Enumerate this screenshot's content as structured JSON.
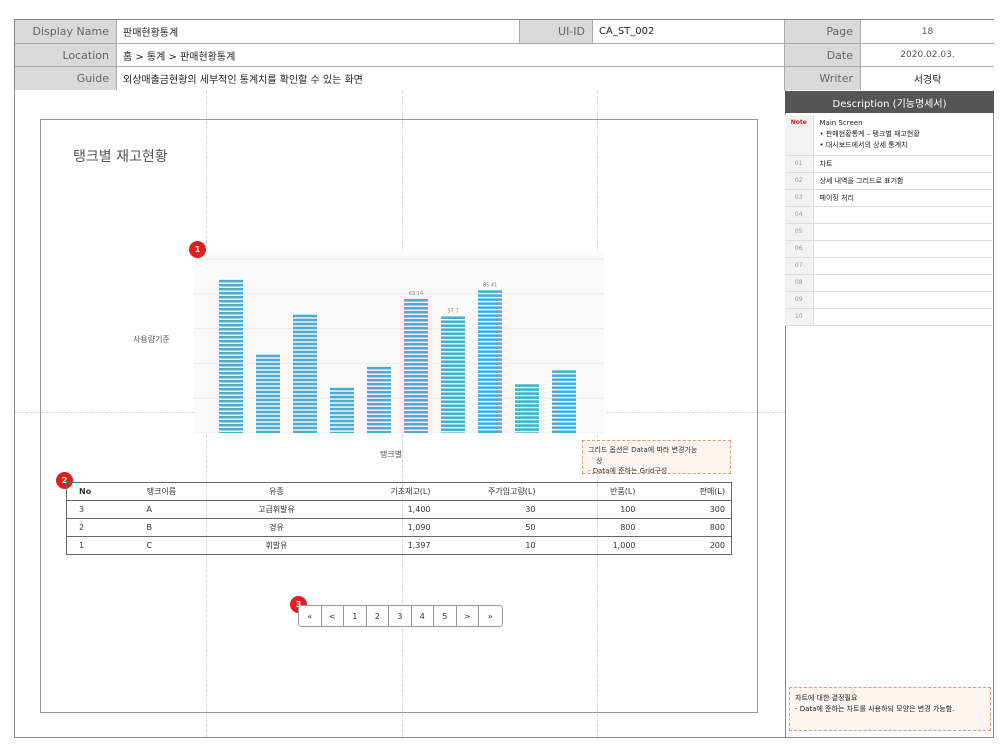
{
  "header": {
    "display_name_label": "Display Name",
    "display_name_value": "판매현황통계",
    "uiid_label": "UI-ID",
    "uiid_value": "CA_ST_002",
    "page_label": "Page",
    "page_value": "18",
    "location_label": "Location",
    "location_value": "홈 > 통계 > 판매현황통계",
    "date_label": "Date",
    "date_value": "2020.02.03.",
    "guide_label": "Guide",
    "guide_value": "외상매출금현황의 세부적인 통계치를 확인할 수 있는 화면",
    "writer_label": "Writer",
    "writer_value": "서경탁"
  },
  "screen": {
    "title": "탱크별 재고현황",
    "chart_ylabel": "사용량기준",
    "chart_xlabel": "탱크별",
    "badge_chart": "1",
    "badge_grid": "2",
    "badge_pager": "3",
    "note_box": {
      "line1": "그리드 옵션은 Data에 따라 변경가능",
      "line1b": "상",
      "line2": "- Data에 준하는 Grid구성"
    }
  },
  "chart_data": {
    "type": "bar",
    "categories": [
      "",
      "",
      "",
      "",
      "",
      "",
      "",
      "",
      "",
      ""
    ],
    "values": [
      88,
      45,
      68,
      26,
      38,
      77,
      67,
      82,
      28,
      36
    ],
    "data_labels": [
      "",
      "",
      "",
      "",
      "",
      "63.14",
      "57.7",
      "85.41",
      "",
      ""
    ],
    "xlabel": "탱크별",
    "ylabel": "사용량기준",
    "ylim": [
      0,
      100
    ],
    "grid": true,
    "bar_color": "#4bacd0"
  },
  "grid": {
    "headers": [
      "No",
      "탱크이름",
      "유종",
      "기초재고(L)",
      "주가입고량(L)",
      "반품(L)",
      "판매(L)"
    ],
    "rows": [
      [
        "3",
        "A",
        "고급휘발유",
        "1,400",
        "30",
        "100",
        "300"
      ],
      [
        "2",
        "B",
        "경유",
        "1,090",
        "50",
        "800",
        "800"
      ],
      [
        "1",
        "C",
        "휘발유",
        "1,397",
        "10",
        "1,000",
        "200"
      ]
    ]
  },
  "pagination": {
    "items": [
      "«",
      "<",
      "1",
      "2",
      "3",
      "4",
      "5",
      ">",
      "»"
    ]
  },
  "description": {
    "title": "Description (기능명세서)",
    "note_label": "Note",
    "note_lines": [
      "Main Screen",
      "• 판매현황통계 – 탱크별 재고현황",
      "• 대시보드에서의 상세 통계치"
    ],
    "rows": [
      {
        "no": "01",
        "text": "차트"
      },
      {
        "no": "02",
        "text": "상세 내역을 그리드로 표기함"
      },
      {
        "no": "03",
        "text": "페이징 처리"
      },
      {
        "no": "04",
        "text": ""
      },
      {
        "no": "05",
        "text": ""
      },
      {
        "no": "06",
        "text": ""
      },
      {
        "no": "07",
        "text": ""
      },
      {
        "no": "08",
        "text": ""
      },
      {
        "no": "09",
        "text": ""
      },
      {
        "no": "10",
        "text": ""
      }
    ],
    "bottom_note_line1": "차트에 대한 결정필요",
    "bottom_note_line2": "- Data에 준하는 차트를 사용하되 모양은 변경 가능함."
  }
}
